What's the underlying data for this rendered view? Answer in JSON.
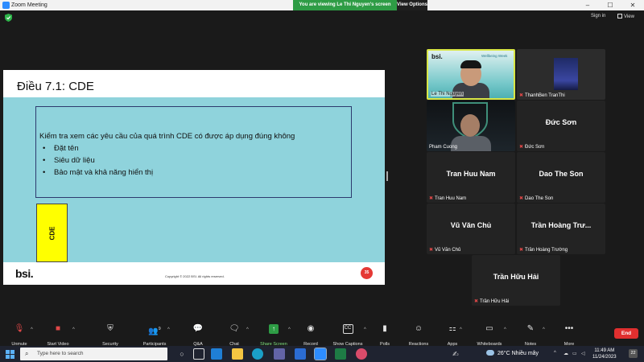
{
  "window": {
    "title": "Zoom Meeting",
    "minimize": "–",
    "maximize": "☐",
    "close": "✕"
  },
  "banner": {
    "message": "You are viewing Le Thi Nguyen's screen",
    "options": "View Options"
  },
  "header": {
    "signin": "Sign in",
    "view": "View"
  },
  "slide": {
    "title": "Điều 7.1: CDE",
    "intro": "Kiểm tra xem các yêu cầu của quá trình CDE có được áp dụng đúng không",
    "bullets": [
      "Đặt tên",
      "Siêu dữ liệu",
      "Bảo mật và khả năng hiển thị"
    ],
    "bullet_symbol": "•",
    "cde_label": "CDE",
    "logo": "bsi.",
    "copyright": "Copyright © 2022 BSI. All rights reserved.",
    "page": "35"
  },
  "participants": [
    {
      "display": "",
      "label": "Le Thi Nguyen",
      "muted": false,
      "video": "slide"
    },
    {
      "display": "",
      "label": "ThanhBen TranThi",
      "muted": true,
      "video": "building"
    },
    {
      "display": "",
      "label": "Pham Cuong",
      "muted": false,
      "video": "person"
    },
    {
      "display": "Đức Sơn",
      "label": "Đức Sơn",
      "muted": true
    },
    {
      "display": "Tran Huu Nam",
      "label": "Tran Huu Nam",
      "muted": true
    },
    {
      "display": "Dao The Son",
      "label": "Dao The Son",
      "muted": true
    },
    {
      "display": "Vũ Văn Chủ",
      "label": "Vũ Văn Chủ",
      "muted": true
    },
    {
      "display": "Trần Hoàng Trư...",
      "label": "Trần Hoàng Trường",
      "muted": true
    },
    {
      "display": "Trần Hữu Hải",
      "label": "Trần Hữu Hải",
      "muted": true
    }
  ],
  "mini_slide": {
    "logo": "bsi.",
    "heading": "Wellbeing Week"
  },
  "toolbar": {
    "unmute": "Unmute",
    "start_video": "Start Video",
    "security": "Security",
    "participants": "Participants",
    "participants_count": "9",
    "qa": "Q&A",
    "chat": "Chat",
    "share": "Share Screen",
    "record": "Record",
    "captions": "Show Captions",
    "captions_icon": "CC",
    "polls": "Polls",
    "reactions": "Reactions",
    "apps": "Apps",
    "whiteboards": "Whiteboards",
    "notes": "Notes",
    "more": "More",
    "end": "End"
  },
  "taskbar": {
    "search_placeholder": "Type here to search",
    "temperature": "26°C",
    "weather": "Nhiều mây",
    "time": "11:49 AM",
    "date": "11/24/2023",
    "notifications": "22"
  },
  "colors": {
    "accent_green": "#2e9c45",
    "end_red": "#e02f2f",
    "slide_teal": "#8fd3dc",
    "cde_yellow": "#ffff00",
    "active_border": "#d8e646"
  }
}
